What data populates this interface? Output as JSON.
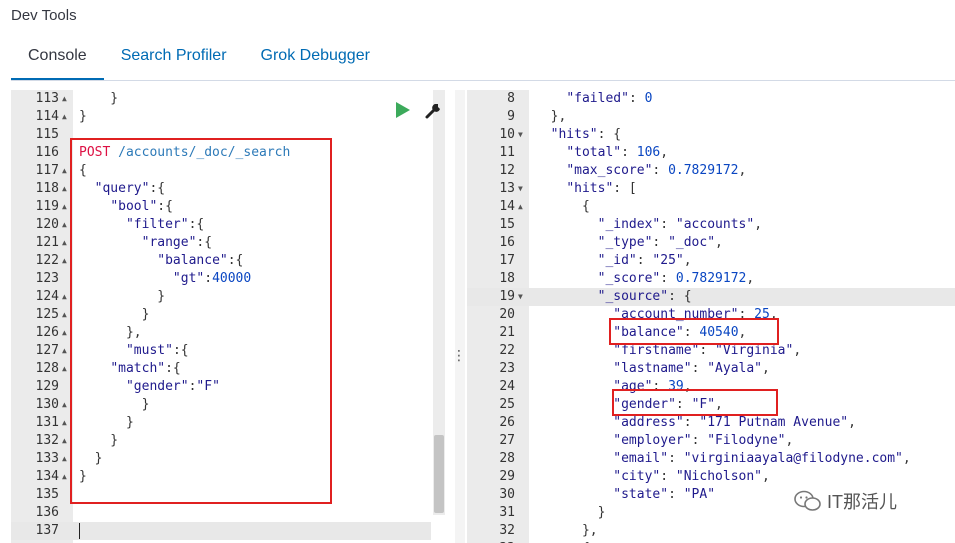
{
  "app": {
    "title": "Dev Tools"
  },
  "tabs": [
    {
      "label": "Console",
      "active": true
    },
    {
      "label": "Search Profiler",
      "active": false
    },
    {
      "label": "Grok Debugger",
      "active": false
    }
  ],
  "request_editor": {
    "first_line": 113,
    "lines": [
      {
        "fold": true,
        "tokens": [
          [
            "p",
            "    }"
          ]
        ]
      },
      {
        "fold": true,
        "tokens": [
          [
            "p",
            "}"
          ]
        ]
      },
      {
        "fold": false,
        "tokens": []
      },
      {
        "fold": false,
        "tokens": [
          [
            "m",
            "POST"
          ],
          [
            "p",
            " "
          ],
          [
            "u",
            "/accounts/_doc/_search"
          ]
        ]
      },
      {
        "fold": true,
        "tokens": [
          [
            "p",
            "{"
          ]
        ]
      },
      {
        "fold": true,
        "tokens": [
          [
            "p",
            "  "
          ],
          [
            "k",
            "\"query\""
          ],
          [
            "p",
            ":{"
          ]
        ]
      },
      {
        "fold": true,
        "tokens": [
          [
            "p",
            "    "
          ],
          [
            "k",
            "\"bool\""
          ],
          [
            "p",
            ":{"
          ]
        ]
      },
      {
        "fold": true,
        "tokens": [
          [
            "p",
            "      "
          ],
          [
            "k",
            "\"filter\""
          ],
          [
            "p",
            ":{"
          ]
        ]
      },
      {
        "fold": true,
        "tokens": [
          [
            "p",
            "        "
          ],
          [
            "k",
            "\"range\""
          ],
          [
            "p",
            ":{"
          ]
        ]
      },
      {
        "fold": true,
        "tokens": [
          [
            "p",
            "          "
          ],
          [
            "k",
            "\"balance\""
          ],
          [
            "p",
            ":{"
          ]
        ]
      },
      {
        "fold": false,
        "tokens": [
          [
            "p",
            "            "
          ],
          [
            "k",
            "\"gt\""
          ],
          [
            "p",
            ":"
          ],
          [
            "n",
            "40000"
          ]
        ]
      },
      {
        "fold": true,
        "tokens": [
          [
            "p",
            "          }"
          ]
        ]
      },
      {
        "fold": true,
        "tokens": [
          [
            "p",
            "        }"
          ]
        ]
      },
      {
        "fold": true,
        "tokens": [
          [
            "p",
            "      },"
          ]
        ]
      },
      {
        "fold": true,
        "tokens": [
          [
            "p",
            "      "
          ],
          [
            "k",
            "\"must\""
          ],
          [
            "p",
            ":{"
          ]
        ]
      },
      {
        "fold": true,
        "tokens": [
          [
            "p",
            "    "
          ],
          [
            "k",
            "\"match\""
          ],
          [
            "p",
            ":{"
          ]
        ]
      },
      {
        "fold": false,
        "tokens": [
          [
            "p",
            "      "
          ],
          [
            "k",
            "\"gender\""
          ],
          [
            "p",
            ":"
          ],
          [
            "s",
            "\"F\""
          ]
        ]
      },
      {
        "fold": true,
        "tokens": [
          [
            "p",
            "        }"
          ]
        ]
      },
      {
        "fold": true,
        "tokens": [
          [
            "p",
            "      }"
          ]
        ]
      },
      {
        "fold": true,
        "tokens": [
          [
            "p",
            "    }"
          ]
        ]
      },
      {
        "fold": true,
        "tokens": [
          [
            "p",
            "  }"
          ]
        ]
      },
      {
        "fold": true,
        "tokens": [
          [
            "p",
            "}"
          ]
        ]
      },
      {
        "fold": false,
        "tokens": []
      },
      {
        "fold": false,
        "tokens": []
      },
      {
        "fold": false,
        "tokens": [],
        "cursor": true,
        "highlight": true
      }
    ]
  },
  "response_editor": {
    "first_line": 8,
    "lines": [
      {
        "fold": false,
        "tokens": [
          [
            "p",
            "    "
          ],
          [
            "k",
            "\"failed\""
          ],
          [
            "p",
            ": "
          ],
          [
            "n",
            "0"
          ]
        ]
      },
      {
        "fold": false,
        "tokens": [
          [
            "p",
            "  },"
          ]
        ]
      },
      {
        "fold": true,
        "tokens": [
          [
            "p",
            "  "
          ],
          [
            "k",
            "\"hits\""
          ],
          [
            "p",
            ": {"
          ]
        ]
      },
      {
        "fold": false,
        "tokens": [
          [
            "p",
            "    "
          ],
          [
            "k",
            "\"total\""
          ],
          [
            "p",
            ": "
          ],
          [
            "n",
            "106"
          ],
          [
            "p",
            ","
          ]
        ]
      },
      {
        "fold": false,
        "tokens": [
          [
            "p",
            "    "
          ],
          [
            "k",
            "\"max_score\""
          ],
          [
            "p",
            ": "
          ],
          [
            "n",
            "0.7829172"
          ],
          [
            "p",
            ","
          ]
        ]
      },
      {
        "fold": true,
        "tokens": [
          [
            "p",
            "    "
          ],
          [
            "k",
            "\"hits\""
          ],
          [
            "p",
            ": ["
          ]
        ]
      },
      {
        "fold": true,
        "tokens": [
          [
            "p",
            "      {"
          ]
        ]
      },
      {
        "fold": false,
        "tokens": [
          [
            "p",
            "        "
          ],
          [
            "k",
            "\"_index\""
          ],
          [
            "p",
            ": "
          ],
          [
            "s",
            "\"accounts\""
          ],
          [
            "p",
            ","
          ]
        ]
      },
      {
        "fold": false,
        "tokens": [
          [
            "p",
            "        "
          ],
          [
            "k",
            "\"_type\""
          ],
          [
            "p",
            ": "
          ],
          [
            "s",
            "\"_doc\""
          ],
          [
            "p",
            ","
          ]
        ]
      },
      {
        "fold": false,
        "tokens": [
          [
            "p",
            "        "
          ],
          [
            "k",
            "\"_id\""
          ],
          [
            "p",
            ": "
          ],
          [
            "s",
            "\"25\""
          ],
          [
            "p",
            ","
          ]
        ]
      },
      {
        "fold": false,
        "tokens": [
          [
            "p",
            "        "
          ],
          [
            "k",
            "\"_score\""
          ],
          [
            "p",
            ": "
          ],
          [
            "n",
            "0.7829172"
          ],
          [
            "p",
            ","
          ]
        ]
      },
      {
        "fold": true,
        "tokens": [
          [
            "p",
            "        "
          ],
          [
            "k",
            "\"_source\""
          ],
          [
            "p",
            ": {"
          ]
        ],
        "highlight": true
      },
      {
        "fold": false,
        "tokens": [
          [
            "p",
            "          "
          ],
          [
            "k",
            "\"account_number\""
          ],
          [
            "p",
            ": "
          ],
          [
            "n",
            "25"
          ],
          [
            "p",
            ","
          ]
        ]
      },
      {
        "fold": false,
        "tokens": [
          [
            "p",
            "          "
          ],
          [
            "k",
            "\"balance\""
          ],
          [
            "p",
            ": "
          ],
          [
            "n",
            "40540"
          ],
          [
            "p",
            ","
          ]
        ]
      },
      {
        "fold": false,
        "tokens": [
          [
            "p",
            "          "
          ],
          [
            "k",
            "\"firstname\""
          ],
          [
            "p",
            ": "
          ],
          [
            "s",
            "\"Virginia\""
          ],
          [
            "p",
            ","
          ]
        ]
      },
      {
        "fold": false,
        "tokens": [
          [
            "p",
            "          "
          ],
          [
            "k",
            "\"lastname\""
          ],
          [
            "p",
            ": "
          ],
          [
            "s",
            "\"Ayala\""
          ],
          [
            "p",
            ","
          ]
        ]
      },
      {
        "fold": false,
        "tokens": [
          [
            "p",
            "          "
          ],
          [
            "k",
            "\"age\""
          ],
          [
            "p",
            ": "
          ],
          [
            "n",
            "39"
          ],
          [
            "p",
            ","
          ]
        ]
      },
      {
        "fold": false,
        "tokens": [
          [
            "p",
            "          "
          ],
          [
            "k",
            "\"gender\""
          ],
          [
            "p",
            ": "
          ],
          [
            "s",
            "\"F\""
          ],
          [
            "p",
            ","
          ]
        ]
      },
      {
        "fold": false,
        "tokens": [
          [
            "p",
            "          "
          ],
          [
            "k",
            "\"address\""
          ],
          [
            "p",
            ": "
          ],
          [
            "s",
            "\"171 Putnam Avenue\""
          ],
          [
            "p",
            ","
          ]
        ]
      },
      {
        "fold": false,
        "tokens": [
          [
            "p",
            "          "
          ],
          [
            "k",
            "\"employer\""
          ],
          [
            "p",
            ": "
          ],
          [
            "s",
            "\"Filodyne\""
          ],
          [
            "p",
            ","
          ]
        ]
      },
      {
        "fold": false,
        "tokens": [
          [
            "p",
            "          "
          ],
          [
            "k",
            "\"email\""
          ],
          [
            "p",
            ": "
          ],
          [
            "s",
            "\"virginiaayala@filodyne.com\""
          ],
          [
            "p",
            ","
          ]
        ]
      },
      {
        "fold": false,
        "tokens": [
          [
            "p",
            "          "
          ],
          [
            "k",
            "\"city\""
          ],
          [
            "p",
            ": "
          ],
          [
            "s",
            "\"Nicholson\""
          ],
          [
            "p",
            ","
          ]
        ]
      },
      {
        "fold": false,
        "tokens": [
          [
            "p",
            "          "
          ],
          [
            "k",
            "\"state\""
          ],
          [
            "p",
            ": "
          ],
          [
            "s",
            "\"PA\""
          ]
        ]
      },
      {
        "fold": false,
        "tokens": [
          [
            "p",
            "        }"
          ]
        ]
      },
      {
        "fold": false,
        "tokens": [
          [
            "p",
            "      },"
          ]
        ]
      },
      {
        "fold": true,
        "tokens": [
          [
            "p",
            "      {"
          ]
        ]
      }
    ]
  },
  "icons": {
    "run": "play-icon",
    "settings": "wrench-icon",
    "resize": "vertical-dots-icon",
    "watermark_logo": "wechat-icon"
  },
  "colors": {
    "accent": "#006bb4",
    "run_button": "#3caa5b",
    "annotation_box": "#e02020"
  },
  "watermark": {
    "text": "IT那活儿"
  }
}
